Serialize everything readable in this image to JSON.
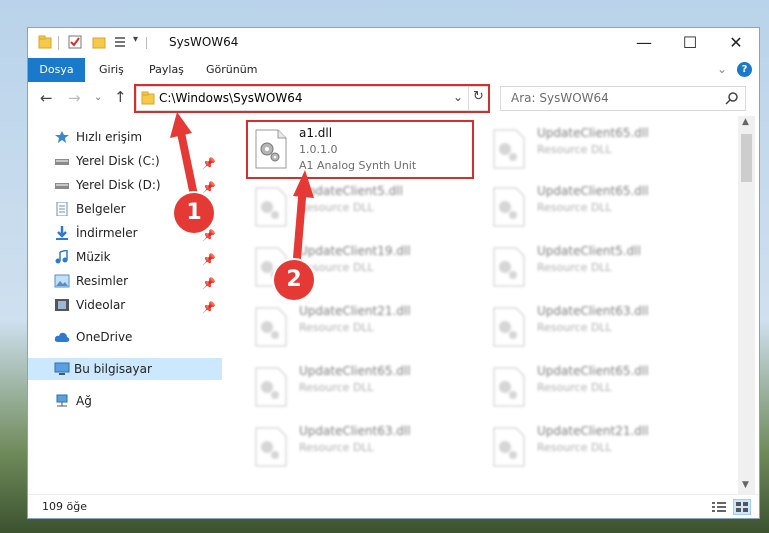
{
  "window": {
    "title": "SysWOW64"
  },
  "ribbon": {
    "tabs": [
      "Dosya",
      "Giriş",
      "Paylaş",
      "Görünüm"
    ]
  },
  "nav": {
    "address": "C:\\Windows\\SysWOW64",
    "search_placeholder": "Ara: SysWOW64"
  },
  "sidebar": {
    "items": [
      {
        "label": "Hızlı erişim",
        "icon": "star-icon"
      },
      {
        "label": "Yerel Disk (C:)",
        "icon": "drive-icon",
        "pinned": true
      },
      {
        "label": "Yerel Disk (D:)",
        "icon": "drive-icon",
        "pinned": true
      },
      {
        "label": "Belgeler",
        "icon": "documents-icon",
        "pinned": true
      },
      {
        "label": "İndirmeler",
        "icon": "download-icon",
        "pinned": true
      },
      {
        "label": "Müzik",
        "icon": "music-icon",
        "pinned": true
      },
      {
        "label": "Resimler",
        "icon": "pictures-icon",
        "pinned": true
      },
      {
        "label": "Videolar",
        "icon": "videos-icon",
        "pinned": true
      },
      {
        "label": "OneDrive",
        "icon": "cloud-icon"
      },
      {
        "label": "Bu bilgisayar",
        "icon": "computer-icon",
        "selected": true
      },
      {
        "label": "Ağ",
        "icon": "network-icon"
      }
    ]
  },
  "files": [
    {
      "name": "a1.dll",
      "line2": "1.0.1.0",
      "line3": "A1 Analog Synth Unit",
      "highlighted": true
    },
    {
      "name": "UpdateClient65.dll",
      "line2": "Resource DLL"
    },
    {
      "name": "UpdateClient5.dll",
      "line2": "Resource DLL"
    },
    {
      "name": "UpdateClient65.dll",
      "line2": "Resource DLL"
    },
    {
      "name": "UpdateClient19.dll",
      "line2": "Resource DLL"
    },
    {
      "name": "UpdateClient5.dll",
      "line2": "Resource DLL"
    },
    {
      "name": "UpdateClient21.dll",
      "line2": "Resource DLL"
    },
    {
      "name": "UpdateClient63.dll",
      "line2": "Resource DLL"
    },
    {
      "name": "UpdateClient65.dll",
      "line2": "Resource DLL"
    },
    {
      "name": "UpdateClient65.dll",
      "line2": "Resource DLL"
    },
    {
      "name": "UpdateClient63.dll",
      "line2": "Resource DLL"
    },
    {
      "name": "UpdateClient21.dll",
      "line2": "Resource DLL"
    }
  ],
  "status": {
    "count": "109 öğe"
  },
  "annotations": {
    "marker1": "1",
    "marker2": "2"
  },
  "colors": {
    "accent": "#1979ca",
    "highlight": "#d32f2f",
    "marker": "#e53935"
  }
}
